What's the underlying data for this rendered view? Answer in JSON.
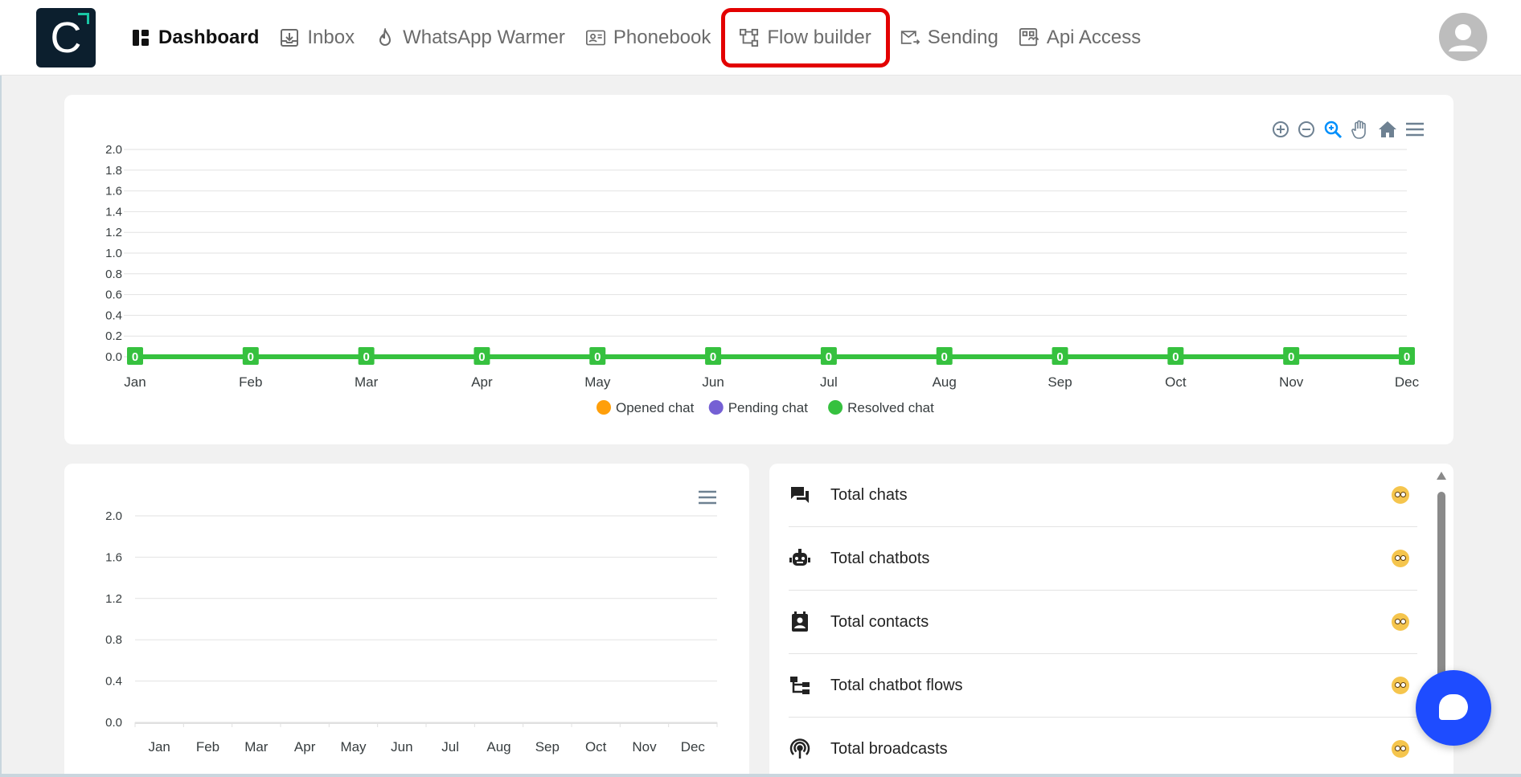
{
  "app": {
    "logo_letter": "C"
  },
  "nav": {
    "items": [
      {
        "label": "Dashboard",
        "icon": "dashboard-icon"
      },
      {
        "label": "Inbox",
        "icon": "inbox-icon"
      },
      {
        "label": "WhatsApp Warmer",
        "icon": "flame-icon"
      },
      {
        "label": "Phonebook",
        "icon": "contact-card-icon"
      },
      {
        "label": "Flow builder",
        "icon": "flow-icon"
      },
      {
        "label": "Sending",
        "icon": "send-mail-icon"
      },
      {
        "label": "Api Access",
        "icon": "api-icon"
      }
    ],
    "active": "Dashboard",
    "highlighted": "Flow builder"
  },
  "main_chart_toolbar": [
    "zoom-in-icon",
    "zoom-out-icon",
    "selection-zoom-icon",
    "pan-hand-icon",
    "home-icon",
    "menu-icon"
  ],
  "chart_data": [
    {
      "type": "line",
      "categories": [
        "Jan",
        "Feb",
        "Mar",
        "Apr",
        "May",
        "Jun",
        "Jul",
        "Aug",
        "Sep",
        "Oct",
        "Nov",
        "Dec"
      ],
      "yticks": [
        "2.0",
        "1.8",
        "1.6",
        "1.4",
        "1.2",
        "1.0",
        "0.8",
        "0.6",
        "0.4",
        "0.2",
        "0.0"
      ],
      "ylim": [
        0,
        2
      ],
      "series": [
        {
          "name": "Opened chat",
          "color": "#ff9f0a",
          "values": [
            0,
            0,
            0,
            0,
            0,
            0,
            0,
            0,
            0,
            0,
            0,
            0
          ]
        },
        {
          "name": "Pending chat",
          "color": "#7560d4",
          "values": [
            0,
            0,
            0,
            0,
            0,
            0,
            0,
            0,
            0,
            0,
            0,
            0
          ]
        },
        {
          "name": "Resolved chat",
          "color": "#36c13f",
          "values": [
            0,
            0,
            0,
            0,
            0,
            0,
            0,
            0,
            0,
            0,
            0,
            0
          ]
        }
      ],
      "data_labels": [
        "0",
        "0",
        "0",
        "0",
        "0",
        "0",
        "0",
        "0",
        "0",
        "0",
        "0",
        "0"
      ],
      "legend": "bottom-center",
      "grid": true
    },
    {
      "type": "bar",
      "categories": [
        "Jan",
        "Feb",
        "Mar",
        "Apr",
        "May",
        "Jun",
        "Jul",
        "Aug",
        "Sep",
        "Oct",
        "Nov",
        "Dec"
      ],
      "yticks": [
        "2.0",
        "1.6",
        "1.2",
        "0.8",
        "0.4",
        "0.0"
      ],
      "ylim": [
        0,
        2
      ],
      "values": [
        0,
        0,
        0,
        0,
        0,
        0,
        0,
        0,
        0,
        0,
        0,
        0
      ],
      "grid": true
    }
  ],
  "stats": [
    {
      "label": "Total chats",
      "icon": "chat-bubbles-icon"
    },
    {
      "label": "Total chatbots",
      "icon": "robot-icon"
    },
    {
      "label": "Total contacts",
      "icon": "contact-icon"
    },
    {
      "label": "Total chatbot flows",
      "icon": "flow-tree-icon"
    },
    {
      "label": "Total broadcasts",
      "icon": "broadcast-icon"
    }
  ],
  "stat_value_icon": "worried-face-icon",
  "colors": {
    "accent": "#1e4cff",
    "highlight_border": "#e30000",
    "resolved": "#36c13f"
  }
}
